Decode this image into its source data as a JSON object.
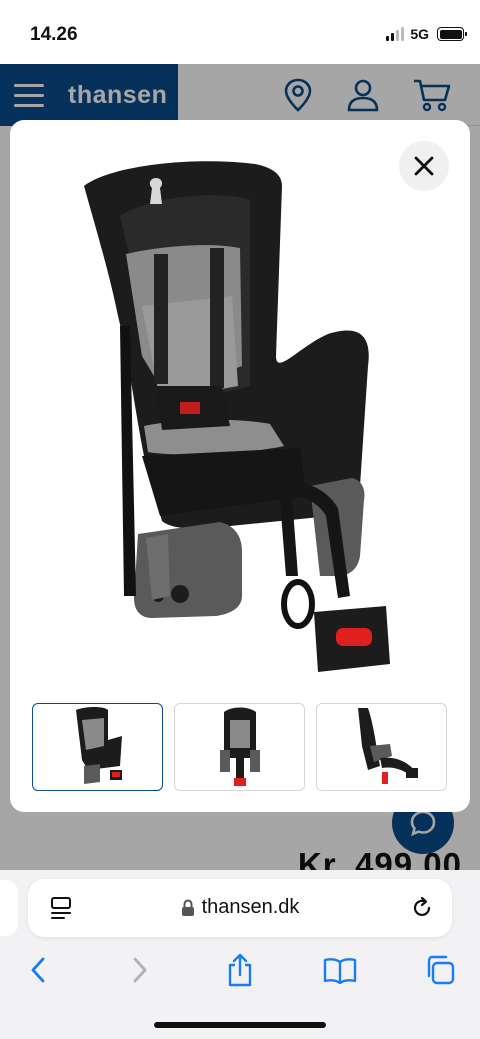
{
  "status_bar": {
    "time": "14.26",
    "network": "5G"
  },
  "header": {
    "logo": "thansen",
    "icons": [
      "menu-icon",
      "location-pin-icon",
      "account-icon",
      "cart-icon"
    ]
  },
  "page": {
    "price": "Kr. 499,00"
  },
  "modal": {
    "close_icon": "close-icon",
    "thumbnails": [
      {
        "view": "front-angle",
        "active": true
      },
      {
        "view": "front",
        "active": false
      },
      {
        "view": "side",
        "active": false
      }
    ]
  },
  "browser": {
    "url": "thansen.dk"
  },
  "colors": {
    "brand": "#0a4c8c",
    "seat_dark": "#1c1c1c",
    "seat_grey": "#7a7a7a",
    "accent_red": "#e02020"
  }
}
